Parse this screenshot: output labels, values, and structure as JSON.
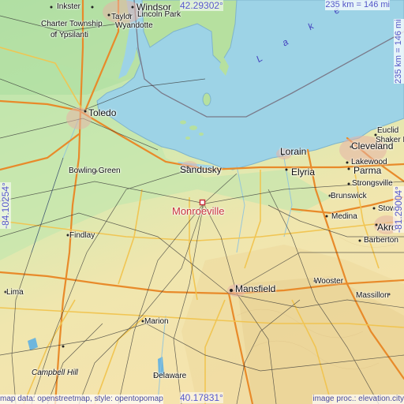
{
  "map": {
    "focus": {
      "name": "Monroeville",
      "color": "#c8323c"
    },
    "coordinates": {
      "north": "42.29302°",
      "south": "40.17831°",
      "west": "-84.10254°",
      "east": "-81.29004°"
    },
    "scale": {
      "horizontal": "235 km = 146 mi",
      "vertical": "235 km = 146 mi"
    },
    "lake_label": "Lake",
    "attribution": {
      "left": "map data: openstreetmap, style: opentopomap",
      "right": "image proc.: elevation.city"
    },
    "places": [
      {
        "key": "inkster",
        "name": "Inkster"
      },
      {
        "key": "taylor",
        "name": "Taylor"
      },
      {
        "key": "windsor",
        "name": "Windsor"
      },
      {
        "key": "lincoln-park",
        "name": "Lincoln Park"
      },
      {
        "key": "charter-township",
        "name": "Charter Township"
      },
      {
        "key": "wyandotte",
        "name": "Wyandotte"
      },
      {
        "key": "of-ypsilanti",
        "name": "of Ypsilanti"
      },
      {
        "key": "toledo",
        "name": "Toledo"
      },
      {
        "key": "sandusky",
        "name": "Sandusky"
      },
      {
        "key": "lorain",
        "name": "Lorain"
      },
      {
        "key": "cleveland",
        "name": "Cleveland"
      },
      {
        "key": "euclid",
        "name": "Euclid"
      },
      {
        "key": "shaker-h",
        "name": "Shaker H"
      },
      {
        "key": "elyria",
        "name": "Elyria"
      },
      {
        "key": "lakewood",
        "name": "Lakewood"
      },
      {
        "key": "parma",
        "name": "Parma"
      },
      {
        "key": "strongsville",
        "name": "Strongsville"
      },
      {
        "key": "brunswick",
        "name": "Brunswick"
      },
      {
        "key": "bowling-green",
        "name": "Bowling Green"
      },
      {
        "key": "medina",
        "name": "Medina"
      },
      {
        "key": "stow",
        "name": "Stow"
      },
      {
        "key": "akron",
        "name": "Akro"
      },
      {
        "key": "findlay",
        "name": "Findlay"
      },
      {
        "key": "barberton",
        "name": "Barberton"
      },
      {
        "key": "mansfield",
        "name": "Mansfield"
      },
      {
        "key": "wooster",
        "name": "Wooster"
      },
      {
        "key": "lima",
        "name": "Lima"
      },
      {
        "key": "massillon",
        "name": "Massillon"
      },
      {
        "key": "marion",
        "name": "Marion"
      },
      {
        "key": "campbell-hill",
        "name": "Campbell Hill"
      },
      {
        "key": "delaware",
        "name": "Delaware"
      }
    ],
    "colors": {
      "water": "#9dd3e6",
      "lowland": "#b7e3a7",
      "upland": "#f1e5a9",
      "motorway": "#e88a2a",
      "trunk": "#f4c85a",
      "coord_text": "#5456c8"
    }
  }
}
